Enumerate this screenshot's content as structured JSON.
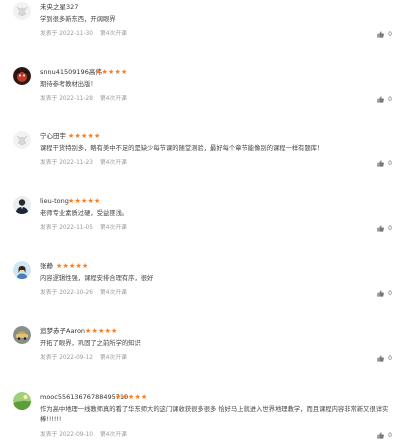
{
  "reviews": [
    {
      "avatar": "wolf-avatar",
      "name": "未央之星327",
      "stars": 0,
      "content": "学到很多新东西，开阔眼界",
      "date": "发表于 2022-11-30",
      "course": "第4次开课",
      "likes": "0"
    },
    {
      "avatar": "dog-avatar",
      "name": "snnu41509196高伟",
      "stars": 5,
      "content": "期待参考教材出版！",
      "date": "发表于 2022-11-28",
      "course": "第4次开课",
      "likes": "0"
    },
    {
      "avatar": "wolf-avatar",
      "name": "宁心田宇",
      "stars": 5,
      "content": "课程干货特别多，略有美中不足的是缺少每节课的随堂测验，最好每个章节能像别的课程一样有题库！",
      "date": "发表于 2022-11-23",
      "course": "第4次开课",
      "likes": "0"
    },
    {
      "avatar": "person-avatar",
      "name": "lieu-tong",
      "stars": 5,
      "content": "老师专业素质过硬，受益匪浅。",
      "date": "发表于 2022-11-05",
      "course": "第4次开课",
      "likes": "0"
    },
    {
      "avatar": "girl-avatar",
      "name": "张静",
      "stars": 5,
      "content": "内容逻辑性强，课程安排合理有序，很好",
      "date": "发表于 2022-10-26",
      "course": "第4次开课",
      "likes": "0"
    },
    {
      "avatar": "car-avatar",
      "name": "追梦赤子Aaron",
      "stars": 5,
      "content": "开拓了眼界，巩固了之前所学的知识",
      "date": "发表于 2022-09-12",
      "course": "第4次开课",
      "likes": "0"
    },
    {
      "avatar": "landscape-avatar",
      "name": "mooc55613676788495710",
      "stars": 5,
      "content": "作为高中地理一线教师真的看了华东师大的这门课收获很多很多 恰好马上就进入世界地理教学，而且课程内容非常新又很详实 棒!!!!!!",
      "date": "发表于 2022-09-10",
      "course": "第4次开课",
      "likes": "0"
    }
  ],
  "colors": {
    "star": "#ff7a1a",
    "meta": "#9a9a9a"
  },
  "icons": {
    "like": "thumbs-up-icon",
    "star": "star-icon"
  }
}
